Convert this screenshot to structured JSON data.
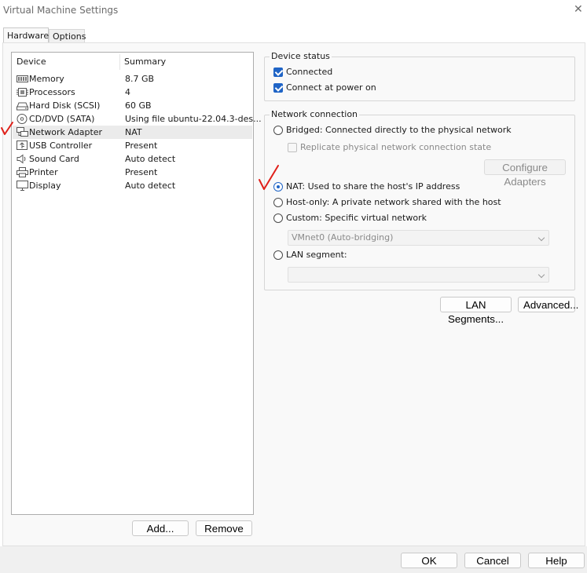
{
  "window": {
    "title": "Virtual Machine Settings",
    "close_glyph": "✕"
  },
  "tabs": [
    {
      "label": "Hardware"
    },
    {
      "label": "Options"
    }
  ],
  "device_list": {
    "columns": {
      "device": "Device",
      "summary": "Summary"
    },
    "rows": [
      {
        "icon": "memory-icon",
        "name": "Memory",
        "summary": "8.7 GB"
      },
      {
        "icon": "processor-icon",
        "name": "Processors",
        "summary": "4"
      },
      {
        "icon": "hard-disk-icon",
        "name": "Hard Disk (SCSI)",
        "summary": "60 GB"
      },
      {
        "icon": "cd-dvd-icon",
        "name": "CD/DVD (SATA)",
        "summary": "Using file ubuntu-22.04.3-des..."
      },
      {
        "icon": "network-adapter-icon",
        "name": "Network Adapter",
        "summary": "NAT"
      },
      {
        "icon": "usb-controller-icon",
        "name": "USB Controller",
        "summary": "Present"
      },
      {
        "icon": "sound-card-icon",
        "name": "Sound Card",
        "summary": "Auto detect"
      },
      {
        "icon": "printer-icon",
        "name": "Printer",
        "summary": "Present"
      },
      {
        "icon": "display-icon",
        "name": "Display",
        "summary": "Auto detect"
      }
    ],
    "selected_row": "Network Adapter"
  },
  "device_buttons": {
    "add": "Add...",
    "remove": "Remove"
  },
  "device_status": {
    "title": "Device status",
    "connected": {
      "label": "Connected",
      "checked": true
    },
    "connect_at_power_on": {
      "label": "Connect at power on",
      "checked": true
    }
  },
  "network_connection": {
    "title": "Network connection",
    "bridged": {
      "label": "Bridged: Connected directly to the physical network",
      "selected": false
    },
    "replicate": {
      "label": "Replicate physical network connection state",
      "checked": false,
      "enabled": false
    },
    "configure_adapters": "Configure Adapters",
    "nat": {
      "label": "NAT: Used to share the host's IP address",
      "selected": true
    },
    "host_only": {
      "label": "Host-only: A private network shared with the host",
      "selected": false
    },
    "custom": {
      "label": "Custom: Specific virtual network",
      "selected": false
    },
    "custom_select": "VMnet0 (Auto-bridging)",
    "lan_segment": {
      "label": "LAN segment:",
      "selected": false
    },
    "lan_segment_select": ""
  },
  "panel_buttons": {
    "lan_segments": "LAN Segments...",
    "advanced": "Advanced..."
  },
  "footer": {
    "ok": "OK",
    "cancel": "Cancel",
    "help": "Help"
  },
  "colors": {
    "accent": "#1f64c6",
    "annotation": "#e0201a",
    "selected_row": "#ebebeb"
  }
}
